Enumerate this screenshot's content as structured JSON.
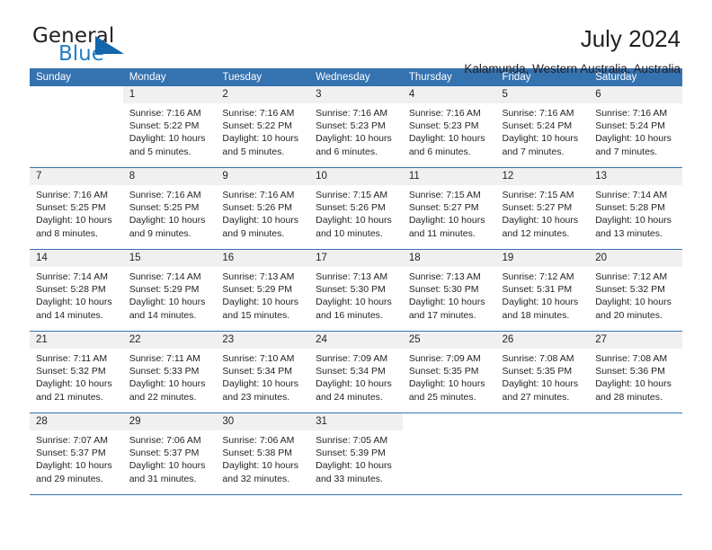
{
  "brand": {
    "name_part1": "General",
    "name_part2": "Blue",
    "logo_icon": "triangle-icon"
  },
  "header": {
    "title": "July 2024",
    "subtitle": "Kalamunda, Western Australia, Australia"
  },
  "colors": {
    "header_blue": "#3572b0",
    "brand_blue": "#1f7fc4",
    "logo_blue": "#1466ab",
    "daynum_bg": "#f0f0f0",
    "text": "#231f20"
  },
  "weekdays": [
    "Sunday",
    "Monday",
    "Tuesday",
    "Wednesday",
    "Thursday",
    "Friday",
    "Saturday"
  ],
  "labels": {
    "sunrise_prefix": "Sunrise:",
    "sunset_prefix": "Sunset:",
    "daylight_prefix": "Daylight:"
  },
  "weeks": [
    [
      {
        "day": "",
        "sunrise": "",
        "sunset": "",
        "daylight": "",
        "blank": true
      },
      {
        "day": "1",
        "sunrise": "Sunrise: 7:16 AM",
        "sunset": "Sunset: 5:22 PM",
        "daylight": "Daylight: 10 hours and 5 minutes."
      },
      {
        "day": "2",
        "sunrise": "Sunrise: 7:16 AM",
        "sunset": "Sunset: 5:22 PM",
        "daylight": "Daylight: 10 hours and 5 minutes."
      },
      {
        "day": "3",
        "sunrise": "Sunrise: 7:16 AM",
        "sunset": "Sunset: 5:23 PM",
        "daylight": "Daylight: 10 hours and 6 minutes."
      },
      {
        "day": "4",
        "sunrise": "Sunrise: 7:16 AM",
        "sunset": "Sunset: 5:23 PM",
        "daylight": "Daylight: 10 hours and 6 minutes."
      },
      {
        "day": "5",
        "sunrise": "Sunrise: 7:16 AM",
        "sunset": "Sunset: 5:24 PM",
        "daylight": "Daylight: 10 hours and 7 minutes."
      },
      {
        "day": "6",
        "sunrise": "Sunrise: 7:16 AM",
        "sunset": "Sunset: 5:24 PM",
        "daylight": "Daylight: 10 hours and 7 minutes."
      }
    ],
    [
      {
        "day": "7",
        "sunrise": "Sunrise: 7:16 AM",
        "sunset": "Sunset: 5:25 PM",
        "daylight": "Daylight: 10 hours and 8 minutes."
      },
      {
        "day": "8",
        "sunrise": "Sunrise: 7:16 AM",
        "sunset": "Sunset: 5:25 PM",
        "daylight": "Daylight: 10 hours and 9 minutes."
      },
      {
        "day": "9",
        "sunrise": "Sunrise: 7:16 AM",
        "sunset": "Sunset: 5:26 PM",
        "daylight": "Daylight: 10 hours and 9 minutes."
      },
      {
        "day": "10",
        "sunrise": "Sunrise: 7:15 AM",
        "sunset": "Sunset: 5:26 PM",
        "daylight": "Daylight: 10 hours and 10 minutes."
      },
      {
        "day": "11",
        "sunrise": "Sunrise: 7:15 AM",
        "sunset": "Sunset: 5:27 PM",
        "daylight": "Daylight: 10 hours and 11 minutes."
      },
      {
        "day": "12",
        "sunrise": "Sunrise: 7:15 AM",
        "sunset": "Sunset: 5:27 PM",
        "daylight": "Daylight: 10 hours and 12 minutes."
      },
      {
        "day": "13",
        "sunrise": "Sunrise: 7:14 AM",
        "sunset": "Sunset: 5:28 PM",
        "daylight": "Daylight: 10 hours and 13 minutes."
      }
    ],
    [
      {
        "day": "14",
        "sunrise": "Sunrise: 7:14 AM",
        "sunset": "Sunset: 5:28 PM",
        "daylight": "Daylight: 10 hours and 14 minutes."
      },
      {
        "day": "15",
        "sunrise": "Sunrise: 7:14 AM",
        "sunset": "Sunset: 5:29 PM",
        "daylight": "Daylight: 10 hours and 14 minutes."
      },
      {
        "day": "16",
        "sunrise": "Sunrise: 7:13 AM",
        "sunset": "Sunset: 5:29 PM",
        "daylight": "Daylight: 10 hours and 15 minutes."
      },
      {
        "day": "17",
        "sunrise": "Sunrise: 7:13 AM",
        "sunset": "Sunset: 5:30 PM",
        "daylight": "Daylight: 10 hours and 16 minutes."
      },
      {
        "day": "18",
        "sunrise": "Sunrise: 7:13 AM",
        "sunset": "Sunset: 5:30 PM",
        "daylight": "Daylight: 10 hours and 17 minutes."
      },
      {
        "day": "19",
        "sunrise": "Sunrise: 7:12 AM",
        "sunset": "Sunset: 5:31 PM",
        "daylight": "Daylight: 10 hours and 18 minutes."
      },
      {
        "day": "20",
        "sunrise": "Sunrise: 7:12 AM",
        "sunset": "Sunset: 5:32 PM",
        "daylight": "Daylight: 10 hours and 20 minutes."
      }
    ],
    [
      {
        "day": "21",
        "sunrise": "Sunrise: 7:11 AM",
        "sunset": "Sunset: 5:32 PM",
        "daylight": "Daylight: 10 hours and 21 minutes."
      },
      {
        "day": "22",
        "sunrise": "Sunrise: 7:11 AM",
        "sunset": "Sunset: 5:33 PM",
        "daylight": "Daylight: 10 hours and 22 minutes."
      },
      {
        "day": "23",
        "sunrise": "Sunrise: 7:10 AM",
        "sunset": "Sunset: 5:34 PM",
        "daylight": "Daylight: 10 hours and 23 minutes."
      },
      {
        "day": "24",
        "sunrise": "Sunrise: 7:09 AM",
        "sunset": "Sunset: 5:34 PM",
        "daylight": "Daylight: 10 hours and 24 minutes."
      },
      {
        "day": "25",
        "sunrise": "Sunrise: 7:09 AM",
        "sunset": "Sunset: 5:35 PM",
        "daylight": "Daylight: 10 hours and 25 minutes."
      },
      {
        "day": "26",
        "sunrise": "Sunrise: 7:08 AM",
        "sunset": "Sunset: 5:35 PM",
        "daylight": "Daylight: 10 hours and 27 minutes."
      },
      {
        "day": "27",
        "sunrise": "Sunrise: 7:08 AM",
        "sunset": "Sunset: 5:36 PM",
        "daylight": "Daylight: 10 hours and 28 minutes."
      }
    ],
    [
      {
        "day": "28",
        "sunrise": "Sunrise: 7:07 AM",
        "sunset": "Sunset: 5:37 PM",
        "daylight": "Daylight: 10 hours and 29 minutes."
      },
      {
        "day": "29",
        "sunrise": "Sunrise: 7:06 AM",
        "sunset": "Sunset: 5:37 PM",
        "daylight": "Daylight: 10 hours and 31 minutes."
      },
      {
        "day": "30",
        "sunrise": "Sunrise: 7:06 AM",
        "sunset": "Sunset: 5:38 PM",
        "daylight": "Daylight: 10 hours and 32 minutes."
      },
      {
        "day": "31",
        "sunrise": "Sunrise: 7:05 AM",
        "sunset": "Sunset: 5:39 PM",
        "daylight": "Daylight: 10 hours and 33 minutes."
      },
      {
        "day": "",
        "sunrise": "",
        "sunset": "",
        "daylight": "",
        "blank": true
      },
      {
        "day": "",
        "sunrise": "",
        "sunset": "",
        "daylight": "",
        "blank": true
      },
      {
        "day": "",
        "sunrise": "",
        "sunset": "",
        "daylight": "",
        "blank": true
      }
    ]
  ]
}
